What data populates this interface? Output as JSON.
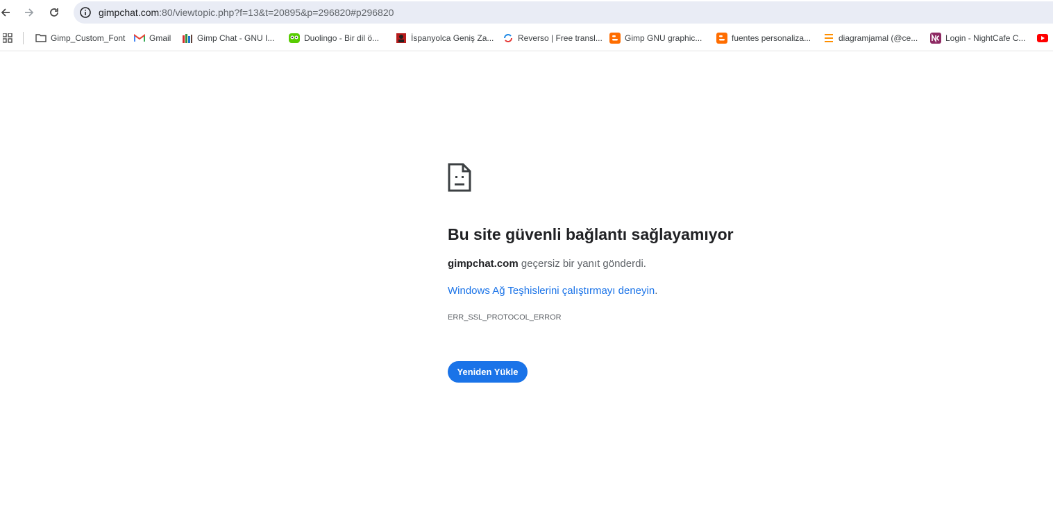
{
  "browser": {
    "url_host": "gimpchat.com",
    "url_rest": ":80/viewtopic.php?f=13&t=20895&p=296820#p296820"
  },
  "bookmarks": [
    {
      "label": "Gimp_Custom_Font",
      "icon": "folder-icon"
    },
    {
      "label": "Gmail",
      "icon": "gmail-icon"
    },
    {
      "label": "Gimp Chat - GNU I...",
      "icon": "gimpchat-icon"
    },
    {
      "label": "Duolingo - Bir dil ö...",
      "icon": "duolingo-icon"
    },
    {
      "label": "İspanyolca Geniş Za...",
      "icon": "book-icon"
    },
    {
      "label": "Reverso | Free transl...",
      "icon": "reverso-icon"
    },
    {
      "label": "Gimp GNU graphic...",
      "icon": "blogger-icon"
    },
    {
      "label": "fuentes personaliza...",
      "icon": "blogger-icon"
    },
    {
      "label": "diagramjamal (@ce...",
      "icon": "substack-icon"
    },
    {
      "label": "Login - NightCafe C...",
      "icon": "nightcafe-icon"
    },
    {
      "label": "",
      "icon": "youtube-icon"
    }
  ],
  "error": {
    "title": "Bu site güvenli bağlantı sağlayamıyor",
    "host": "gimpchat.com",
    "desc_suffix": " geçersiz bir yanıt gönderdi.",
    "link_text": "Windows Ağ Teşhislerini çalıştırmayı deneyin",
    "link_suffix": ".",
    "code": "ERR_SSL_PROTOCOL_ERROR",
    "reload_label": "Yeniden Yükle"
  },
  "colors": {
    "accent": "#1a73e8",
    "omnibox_bg": "#e9ecf5",
    "text_primary": "#202124",
    "text_secondary": "#5f6368"
  }
}
